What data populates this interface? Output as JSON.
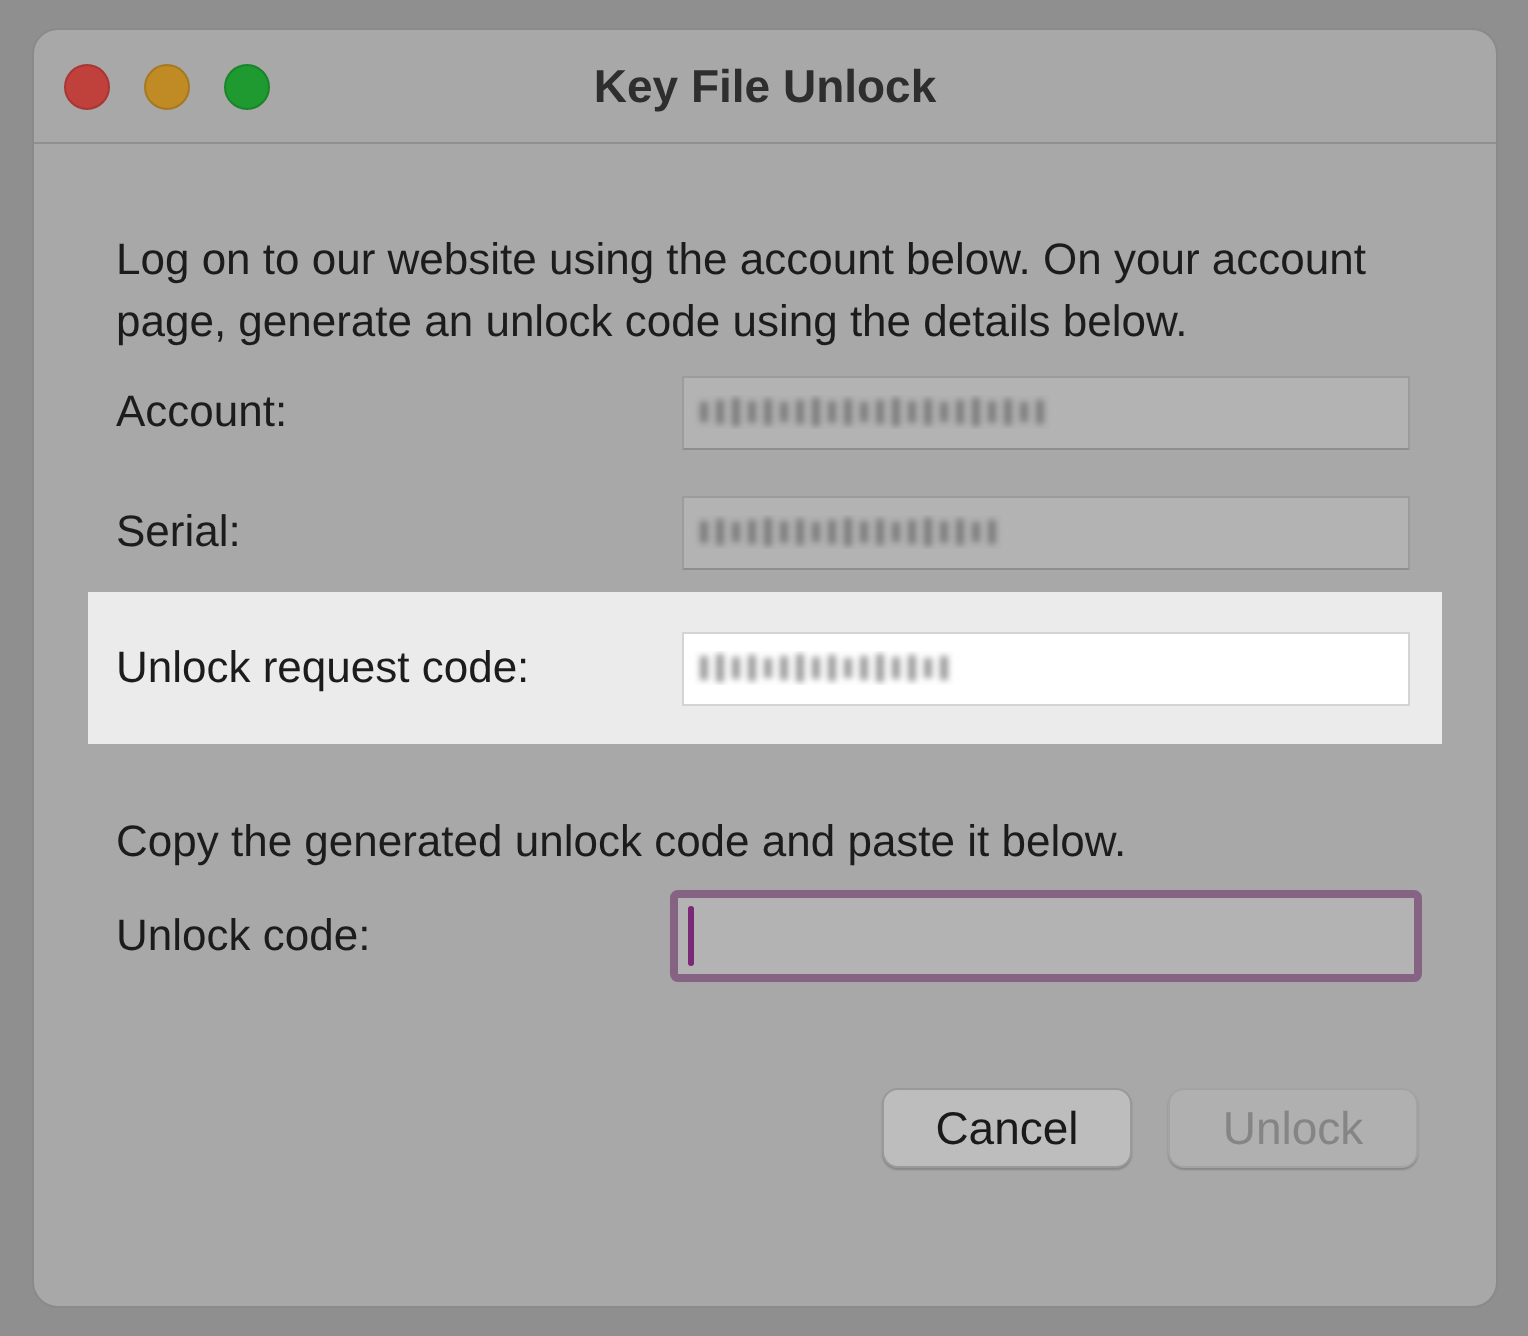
{
  "window": {
    "title": "Key File Unlock"
  },
  "instructions": "Log on to our website using the account below. On your account page, generate an unlock code using the details below.",
  "fields": [
    {
      "label": "Account:",
      "highlighted": false
    },
    {
      "label": "Serial:",
      "highlighted": false
    },
    {
      "label": "Unlock request code:",
      "highlighted": true
    }
  ],
  "paste_instructions": "Copy the generated unlock code and paste it below.",
  "unlock_code": {
    "label": "Unlock code:",
    "focused": true
  },
  "buttons": [
    {
      "label": "Cancel",
      "disabled": false
    },
    {
      "label": "Unlock",
      "disabled": true
    }
  ]
}
